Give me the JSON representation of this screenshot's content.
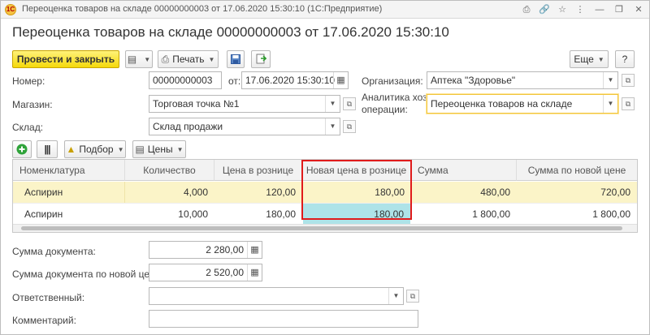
{
  "window": {
    "title": "Переоценка товаров на складе 00000000003 от 17.06.2020 15:30:10 (1С:Предприятие)",
    "logo": "1С"
  },
  "titlebar_icons": [
    "print-icon",
    "link-icon",
    "star-icon",
    "more-icon",
    "minimize-icon",
    "restore-icon",
    "close-icon"
  ],
  "titlebar_glyphs": [
    "⎙",
    "🔗",
    "☆",
    "⋮",
    "—",
    "❐",
    "✕"
  ],
  "document": {
    "title": "Переоценка товаров на складе 00000000003 от 17.06.2020 15:30:10"
  },
  "toolbar": {
    "post_close": "Провести и закрыть",
    "print": "Печать",
    "more": "Еще",
    "help": "?"
  },
  "form": {
    "number_label": "Номер:",
    "number_value": "00000000003",
    "date_label": "от:",
    "date_value": "17.06.2020 15:30:10",
    "org_label": "Организация:",
    "org_value": "Аптека \"Здоровье\"",
    "store_label": "Магазин:",
    "store_value": "Торговая точка №1",
    "analytics_label_1": "Аналитика хоз.",
    "analytics_label_2": "операции:",
    "analytics_value": "Переоценка товаров на складе",
    "warehouse_label": "Склад:",
    "warehouse_value": "Склад продажи"
  },
  "table_toolbar": {
    "select": "Подбор",
    "prices": "Цены"
  },
  "table": {
    "columns": [
      "Номенклатура",
      "Количество",
      "Цена в рознице",
      "Новая цена в рознице",
      "Сумма",
      "Сумма по новой цене"
    ],
    "rows": [
      {
        "item": "Аспирин",
        "qty": "4,000",
        "price": "120,00",
        "new_price": "180,00",
        "sum": "480,00",
        "new_sum": "720,00"
      },
      {
        "item": "Аспирин",
        "qty": "10,000",
        "price": "180,00",
        "new_price": "180,00",
        "sum": "1 800,00",
        "new_sum": "1 800,00"
      }
    ]
  },
  "footer": {
    "doc_sum_label": "Сумма документа:",
    "doc_sum_value": "2 280,00",
    "doc_sum_new_label": "Сумма документа по новой цене:",
    "doc_sum_new_value": "2 520,00",
    "responsible_label": "Ответственный:",
    "responsible_value": "",
    "comment_label": "Комментарий:",
    "comment_value": ""
  },
  "colors": {
    "primary_button": "#f5d90a",
    "selected_row": "#fbf4c8",
    "active_cell": "#aee3e8",
    "highlight_frame": "#e01b1b",
    "focus_border": "#f0c43a"
  }
}
